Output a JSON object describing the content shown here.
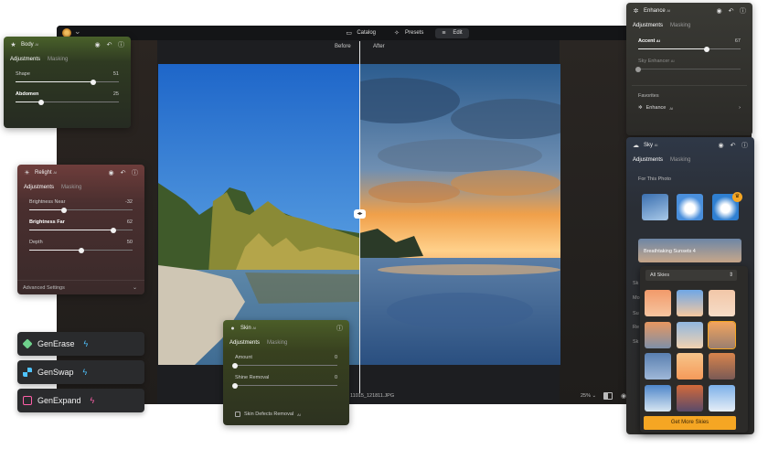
{
  "topbar": {
    "tabs": [
      {
        "label": "Catalog",
        "icon": "folder-icon"
      },
      {
        "label": "Presets",
        "icon": "presets-icon"
      },
      {
        "label": "Edit",
        "icon": "edit-sliders-icon"
      }
    ]
  },
  "compare": {
    "before": "Before",
    "after": "After"
  },
  "statusbar": {
    "filename": "11015_121811.JPG",
    "zoom": "25% ⌄"
  },
  "body_panel": {
    "title": "Body",
    "sup": "AI",
    "tabs": [
      "Adjustments",
      "Masking"
    ],
    "sliders": [
      {
        "label": "Shape",
        "value": "51",
        "level": 0.75
      },
      {
        "label": "Abdomen",
        "value": "25",
        "level": 0.25
      }
    ]
  },
  "relight_panel": {
    "title": "Relight",
    "sup": "AI",
    "tabs": [
      "Adjustments",
      "Masking"
    ],
    "sliders": [
      {
        "label": "Brightness Near",
        "value": "-32",
        "level": 0.34
      },
      {
        "label": "Brightness Far",
        "value": "62",
        "level": 0.81
      },
      {
        "label": "Depth",
        "value": "50",
        "level": 0.5
      }
    ],
    "advanced": "Advanced Settings"
  },
  "skin_panel": {
    "title": "Skin",
    "sup": "AI",
    "tabs": [
      "Adjustments",
      "Masking"
    ],
    "sliders": [
      {
        "label": "Amount",
        "value": "0",
        "level": 0.0
      },
      {
        "label": "Shine Removal",
        "value": "0",
        "level": 0.0
      }
    ],
    "checkbox": "Skin Defects Removal",
    "checkbox_sup": "AI"
  },
  "gen_buttons": [
    {
      "label": "GenErase",
      "spark_color": "#4fc3ff"
    },
    {
      "label": "GenSwap",
      "spark_color": "#4fc3ff"
    },
    {
      "label": "GenExpand",
      "spark_color": "#ff5fa8"
    }
  ],
  "enhance_panel": {
    "title": "Enhance",
    "sup": "AI",
    "tabs": [
      "Adjustments",
      "Masking"
    ],
    "sliders": [
      {
        "label": "Accent",
        "sup": "AI",
        "value": "67",
        "level": 0.67
      },
      {
        "label": "Sky Enhancer",
        "sup": "AI",
        "value": "",
        "level": 0.0
      }
    ],
    "favorites_title": "Favorites",
    "favorite_item": "Enhance",
    "favorite_sup": "AI"
  },
  "sky_panel": {
    "title": "Sky",
    "sup": "AI",
    "tabs": [
      "Adjustments",
      "Masking"
    ],
    "for_this_photo": "For This Photo",
    "featured": "Breathtaking Sunsets 4",
    "select_value": "All Skies",
    "get_more": "Get More Skies",
    "side_labels": [
      "Sk",
      "Mo",
      "Su",
      "Re",
      "Sk"
    ]
  },
  "colors": {
    "accent": "#f5a623",
    "body_head": "#49612a",
    "relight_head": "#6e3d3b",
    "skin_head": "#4b5d28"
  }
}
